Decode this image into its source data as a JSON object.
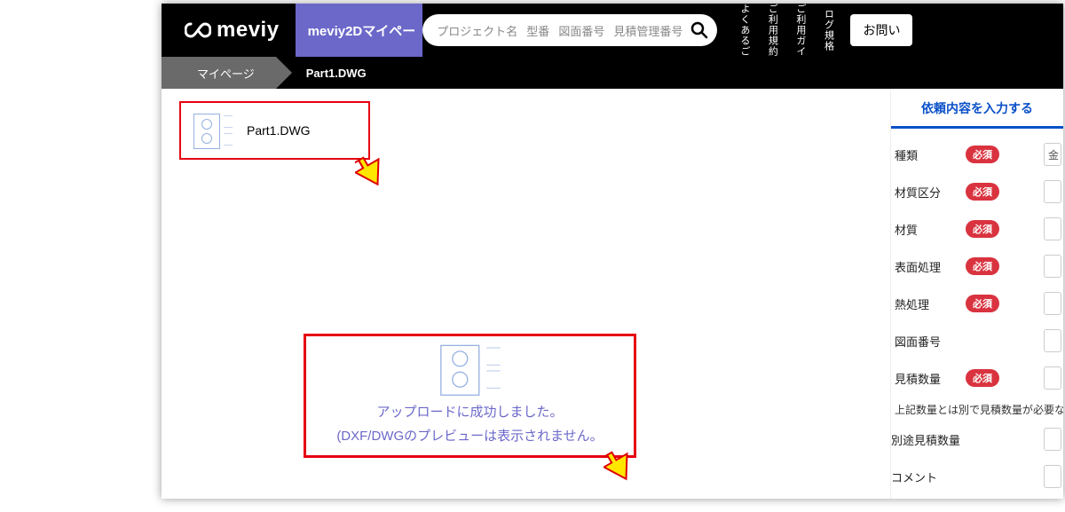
{
  "header": {
    "logo_text": "meviy",
    "active_tab": "meviy2Dマイペー",
    "search_placeholders": [
      "プロジェクト名",
      "型番",
      "図面番号",
      "見積管理番号"
    ],
    "top_links": [
      "よくあるご",
      "ご利用規約",
      "ご利用ガイ",
      "ログ規格"
    ],
    "contact_button": "お問い"
  },
  "breadcrumb": {
    "first": "マイページ",
    "second": "Part1.DWG"
  },
  "file_card": {
    "name": "Part1.DWG"
  },
  "upload_msg": {
    "line1": "アップロードに成功しました。",
    "line2": "(DXF/DWGのプレビューは表示されません。"
  },
  "right_panel": {
    "tab_title": "依頼内容を入力する",
    "required_badge": "必須",
    "rows": [
      {
        "label": "種類",
        "required": true,
        "hint": "金"
      },
      {
        "label": "材質区分",
        "required": true,
        "hint": ""
      },
      {
        "label": "材質",
        "required": true,
        "hint": ""
      },
      {
        "label": "表面処理",
        "required": true,
        "hint": ""
      },
      {
        "label": "熱処理",
        "required": true,
        "hint": ""
      },
      {
        "label": "図面番号",
        "required": false,
        "hint": ""
      },
      {
        "label": "見積数量",
        "required": true,
        "hint": ""
      }
    ],
    "note": "上記数量とは別で見積数量が必要な",
    "extra_qty_label": "別途見積数量",
    "comment_label": "コメント"
  }
}
